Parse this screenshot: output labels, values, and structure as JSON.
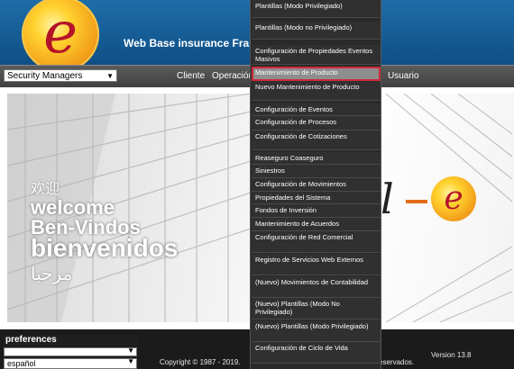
{
  "header": {
    "logo_letter": "e",
    "app_title": "Web Base insurance Fram"
  },
  "navbar": {
    "role_select": {
      "value": "Security Managers"
    },
    "items": [
      "Cliente",
      "Operación",
      "Usuario"
    ]
  },
  "hero": {
    "welcome_zh": "欢迎",
    "welcome_en": "welcome",
    "welcome_pt": "Ben-Vindos",
    "welcome_es": "bienvenidos",
    "welcome_ar": "مرحبا",
    "brand_l": "l",
    "brand_e": "e"
  },
  "dropdown": {
    "items": [
      "Plantillas (Modo Privilegiado)",
      "Plantillas (Modo no Privilegiado)",
      "Configuración de Propiedades Eventos Masivos",
      "Mantenimiento de Producto",
      "Nuevo Mantenimiento de Producto",
      "Configuración de Eventos",
      "Configuración de Procesos",
      "Configuración de Cotizaciones",
      "Reaseguro Coaseguro",
      "Siniestros",
      "Configuración de Movimientos",
      "Propiedades del Sistema",
      "Fondos de Inversión",
      "Mantenimiento de Acuerdos",
      "Configuración de Red Comercial",
      "Registro de Servicios Web Externos",
      "(Nuevo) Movimientos de Contabilidad",
      "(Nuevo) Plantillas (Modo No Privilegiado)",
      "(Nuevo) Plantillas (Modo Privilegiado)",
      "Configuración de Ciclo de Vida"
    ],
    "highlighted_index": 3,
    "highlight_color": "#d0283a"
  },
  "footer": {
    "preferences_title": "preferences",
    "preferences_value": "",
    "language_value": "español",
    "copyright": "Copyright © 1987 - 2019.",
    "copyright_tail": "eservados.",
    "version": "Version 13.8"
  },
  "colors": {
    "header_blue": "#1666a0",
    "nav_gray": "#4a4a4a",
    "menu_bg": "#303030",
    "logo_red": "#b4142a"
  }
}
